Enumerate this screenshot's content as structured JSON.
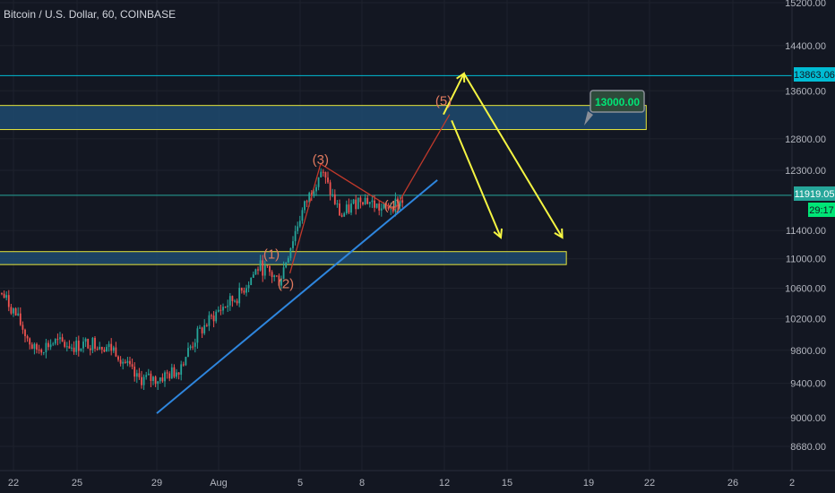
{
  "header": {
    "symbol_title": "Bitcoin / U.S. Dollar, 60, COINBASE"
  },
  "chart_data": {
    "type": "candlestick",
    "title": "Bitcoin / U.S. Dollar, 60, COINBASE",
    "y_scale": "log",
    "ylim": [
      8450,
      15300
    ],
    "y_ticks": [
      15200,
      14400,
      13600,
      12800,
      12300,
      11400,
      11000,
      10600,
      10200,
      9800,
      9400,
      9000,
      8680
    ],
    "x_ticks": [
      "22",
      "25",
      "29",
      "Aug",
      "5",
      "8",
      "12",
      "15",
      "19",
      "22",
      "26",
      "2"
    ],
    "price_series": [
      {
        "date": "Jul 21",
        "price": 10700
      },
      {
        "date": "Jul 22",
        "price": 10300
      },
      {
        "date": "Jul 23",
        "price": 9800
      },
      {
        "date": "Jul 24",
        "price": 9900
      },
      {
        "date": "Jul 25",
        "price": 9850
      },
      {
        "date": "Jul 26",
        "price": 9900
      },
      {
        "date": "Jul 27",
        "price": 9800
      },
      {
        "date": "Jul 28",
        "price": 9450
      },
      {
        "date": "Jul 29",
        "price": 9450
      },
      {
        "date": "Jul 30",
        "price": 9550
      },
      {
        "date": "Jul 31",
        "price": 10000
      },
      {
        "date": "Aug 1",
        "price": 10300
      },
      {
        "date": "Aug 2",
        "price": 10500
      },
      {
        "date": "Aug 3",
        "price": 10900
      },
      {
        "date": "Aug 4",
        "price": 10700
      },
      {
        "date": "Aug 5",
        "price": 11600
      },
      {
        "date": "Aug 6",
        "price": 12300
      },
      {
        "date": "Aug 7",
        "price": 11600
      },
      {
        "date": "Aug 8",
        "price": 11900
      },
      {
        "date": "Aug 9",
        "price": 11700
      },
      {
        "date": "Aug 10",
        "price": 11850
      }
    ],
    "wave_labels": [
      {
        "label": "(1)",
        "date": "Aug 3.6",
        "price": 11000
      },
      {
        "label": "(2)",
        "date": "Aug 4.3",
        "price": 10600
      },
      {
        "label": "(3)",
        "date": "Aug 6",
        "price": 12400
      },
      {
        "label": "(4)",
        "date": "Aug 9.5",
        "price": 11700
      },
      {
        "label": "(5)",
        "date": "Aug 12",
        "price": 13350
      }
    ],
    "projection_path": [
      {
        "date": "Aug 9.6",
        "price": 11700
      },
      {
        "date": "Aug 12.3",
        "price": 13200
      }
    ],
    "wave_path": [
      {
        "date": "Aug 4.5",
        "price": 10800
      },
      {
        "date": "Aug 6",
        "price": 12400
      },
      {
        "date": "Aug 9.6",
        "price": 11700
      }
    ],
    "trendline": [
      {
        "date": "Jul 29",
        "price": 9050
      },
      {
        "date": "Aug 11.7",
        "price": 12150
      }
    ],
    "zones": [
      {
        "name": "resistance-zone",
        "from_date": "Jul 20",
        "to_date": "Aug 21.9",
        "low": 12950,
        "high": 13350
      },
      {
        "name": "support-zone",
        "from_date": "Jul 21",
        "to_date": "Aug 18",
        "low": 10920,
        "high": 11100
      }
    ],
    "arrows": [
      {
        "from": {
          "date": "Aug 12",
          "price": 13200
        },
        "to": {
          "date": "Aug 13",
          "price": 13900
        }
      },
      {
        "from": {
          "date": "Aug 13",
          "price": 13900
        },
        "to": {
          "date": "Aug 17.8",
          "price": 11300
        }
      },
      {
        "from": {
          "date": "Aug 12.4",
          "price": 13100
        },
        "to": {
          "date": "Aug 14.8",
          "price": 11300
        }
      }
    ],
    "horizontal_lines": [
      {
        "name": "cyan-line",
        "price": 13863.06,
        "color": "#00bcd4"
      },
      {
        "name": "green-line",
        "price": 11919.05,
        "color": "#26a69a"
      }
    ],
    "price_tags": {
      "cyan": "13863.06",
      "green": "11919.05",
      "countdown": "29:17",
      "callout": "13000.00"
    },
    "colors": {
      "background": "#131722",
      "up_candle": "#26a69a",
      "down_candle": "#ef5350",
      "zone_fill": "#1e4a6e",
      "zone_border": "#e6e63c",
      "arrow": "#f5f542",
      "trendline": "#2e86de",
      "wave_label": "#e07a5f",
      "callout_bg": "#2e4a3a",
      "callout_text": "#00e676"
    }
  }
}
